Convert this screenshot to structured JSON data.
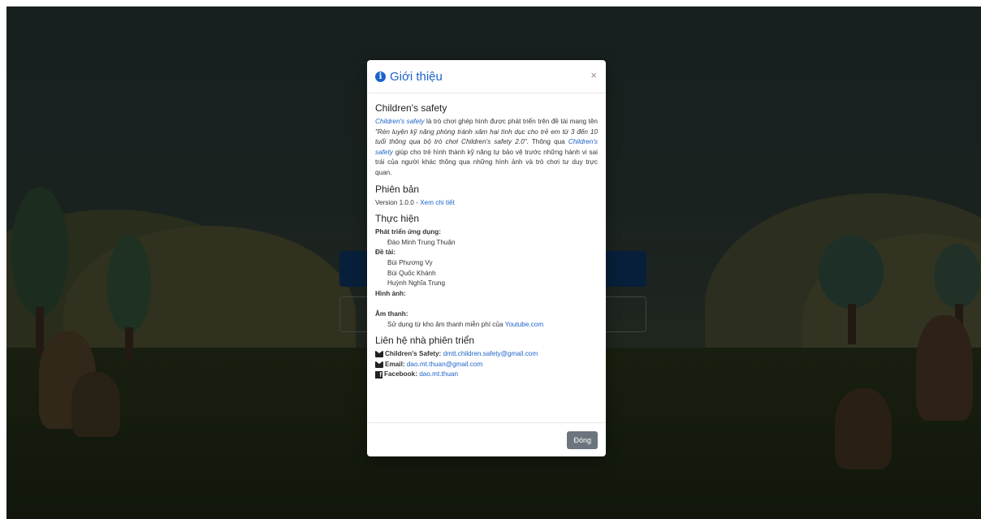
{
  "colors": {
    "accent": "#1b63c9",
    "secondary_button": "#6c757d"
  },
  "background": {
    "primary_button_label": "",
    "outline_button_label": ""
  },
  "modal": {
    "title": "Giới thiệu",
    "title_icon": "info-circle-icon",
    "close_symbol": "×",
    "sections": {
      "about": {
        "heading": "Children's safety",
        "desc_link_1": "Children's safety",
        "desc_text_1": " là trò chơi ghép hình được phát triển trên đề tài mang tên ",
        "desc_quote": "\"Rèn luyện kỹ năng phòng tránh xâm hại tình dục cho trẻ em từ 3 đến 10 tuổi thông qua bộ trò chơi Children's safety 2.0\"",
        "desc_text_2": ". Thông qua ",
        "desc_link_2": "Children's safety",
        "desc_text_3": " giúp cho trẻ hình thành kỹ năng tự bảo vệ trước những hành vi sai trái của người khác thông qua những hình ảnh và trò chơi tư duy trực quan."
      },
      "version": {
        "heading": "Phiên bản",
        "text": "Version 1.0.0 - ",
        "link": "Xem chi tiết"
      },
      "credits": {
        "heading": "Thực hiện",
        "dev_label": "Phát triển ứng dụng:",
        "developers": [
          "Đào Minh Trung Thuận"
        ],
        "topic_label": "Đề tài:",
        "topic_members": [
          "Bùi Phương Vy",
          "Bùi Quốc Khánh",
          "Huỳnh Nghĩa Trung"
        ],
        "images_label": "Hình ảnh:",
        "sound_label": "Âm thanh:",
        "sound_text": "Sử dụng từ kho âm thanh miễn phí của ",
        "sound_link": "Youtube.com"
      },
      "contact": {
        "heading": "Liên hệ nhà phiên triển",
        "items": [
          {
            "icon": "envelope-icon",
            "label": "Children's Safety:",
            "value": "dmtt.children.safety@gmail.com"
          },
          {
            "icon": "envelope-icon",
            "label": "Email:",
            "value": "dao.mt.thuan@gmail.com"
          },
          {
            "icon": "facebook-icon",
            "label": "Facebook:",
            "value": "dao.mt.thuan"
          }
        ]
      }
    },
    "footer": {
      "close_label": "Đóng"
    }
  }
}
